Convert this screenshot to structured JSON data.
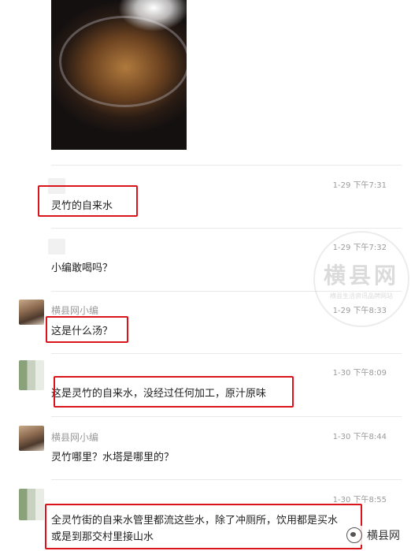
{
  "messages": [
    {
      "time": "1-29 下午7:31",
      "sender": "",
      "text": "灵竹的自来水"
    },
    {
      "time": "1-29 下午7:32",
      "sender": "",
      "text": "小编敢喝吗？"
    },
    {
      "time": "1-29 下午8:33",
      "sender": "横县网小编",
      "text": "这是什么汤？"
    },
    {
      "time": "1-30 下午8:09",
      "sender": "",
      "text": "这是灵竹的自来水，没经过任何加工，原汁原味"
    },
    {
      "time": "1-30 下午8:44",
      "sender": "横县网小编",
      "text": "灵竹哪里？水塔是哪里的？"
    },
    {
      "time": "1-30 下午8:55",
      "sender": "",
      "text_line1": "全灵竹街的自来水管里都流这些水，除了冲厕所，饮用都是买水",
      "text_line2": "或是到那交村里接山水"
    }
  ],
  "watermark": {
    "big": "横县网",
    "small": "横县生活资讯品牌网站"
  },
  "corner_label": "横县网",
  "colors": {
    "highlight": "#d9141b",
    "muted": "#9a9a9a"
  }
}
